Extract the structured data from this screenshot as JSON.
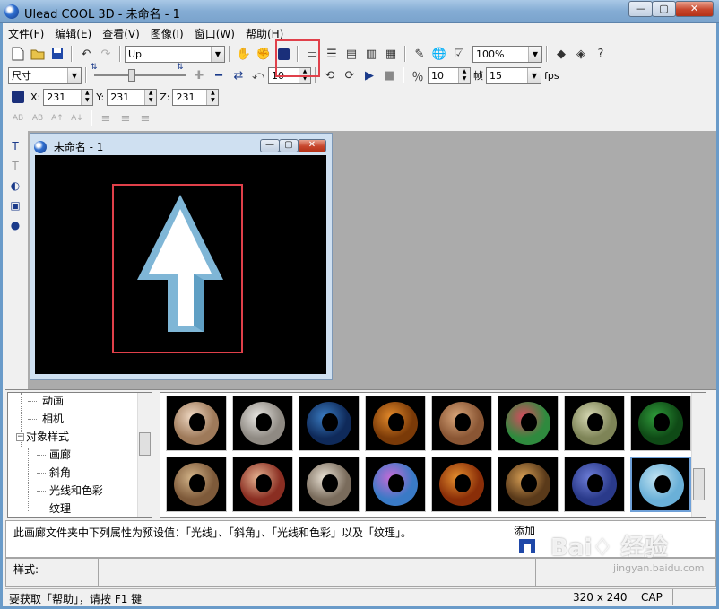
{
  "window": {
    "title": "Ulead COOL 3D - 未命名 - 1",
    "min_label": "—",
    "max_label": "▢",
    "close_label": "✕"
  },
  "menu": [
    {
      "label": "文件(F)"
    },
    {
      "label": "编辑(E)"
    },
    {
      "label": "查看(V)"
    },
    {
      "label": "图像(I)"
    },
    {
      "label": "窗口(W)"
    },
    {
      "label": "帮助(H)"
    }
  ],
  "toolbar1": {
    "object_combo": "Up",
    "zoom_combo": "100%"
  },
  "toolbar2": {
    "mode_combo": "尺寸",
    "value1": "10",
    "frame_value": "10",
    "frame_label": "帧",
    "fps_value": "15",
    "fps_label": "fps"
  },
  "toolbar3": {
    "x_label": "X:",
    "x_value": "231",
    "y_label": "Y:",
    "y_value": "231",
    "z_label": "Z:",
    "z_value": "231"
  },
  "document": {
    "title": "未命名 - 1"
  },
  "tree": {
    "items": [
      {
        "label": "动画",
        "level": 1
      },
      {
        "label": "相机",
        "level": 1
      },
      {
        "label": "对象样式",
        "level": 0
      },
      {
        "label": "画廊",
        "level": 1
      },
      {
        "label": "斜角",
        "level": 1
      },
      {
        "label": "光线和色彩",
        "level": 1
      },
      {
        "label": "纹理",
        "level": 1
      }
    ],
    "expander_label": "−"
  },
  "thumbnails": [
    {
      "colors": [
        "#f0d9c4",
        "#9e7a5a"
      ]
    },
    {
      "colors": [
        "#e8e6e2",
        "#8f8a83"
      ]
    },
    {
      "colors": [
        "#3a7cc2",
        "#0f2a5a"
      ]
    },
    {
      "colors": [
        "#e38a2b",
        "#7a3a08"
      ]
    },
    {
      "colors": [
        "#d9a67a",
        "#8a5634"
      ]
    },
    {
      "colors": [
        "#d64b5e",
        "#2f8a3e"
      ]
    },
    {
      "colors": [
        "#d7d9b4",
        "#7e8457"
      ]
    },
    {
      "colors": [
        "#2f9a3a",
        "#0f4a16"
      ]
    },
    {
      "colors": [
        "#d3b489",
        "#7e5a3a"
      ]
    },
    {
      "colors": [
        "#e6b492",
        "#8a2e22"
      ]
    },
    {
      "colors": [
        "#e9e1d4",
        "#7a6c5c"
      ]
    },
    {
      "colors": [
        "#c56bd6",
        "#3a7ac6"
      ]
    },
    {
      "colors": [
        "#e5902f",
        "#8a2e08"
      ]
    },
    {
      "colors": [
        "#d69e54",
        "#5a3a1a"
      ]
    },
    {
      "colors": [
        "#6e7ed8",
        "#2a3a8a"
      ]
    },
    {
      "colors": [
        "#c2e4f2",
        "#6ab0d8"
      ]
    }
  ],
  "description": {
    "text": "此画廊文件夹中下列属性为预设值：「光线」、「斜角」、「光线和色彩」以及「纹理」。",
    "add_label": "添加"
  },
  "style_area": {
    "label": "样式:"
  },
  "statusbar": {
    "text": "要获取「帮助」，请按 F1 键",
    "resolution": "320 x 240",
    "cap": "CAP"
  },
  "watermark": {
    "main": "Bai♢ 经验",
    "sub": "jingyan.baidu.com"
  },
  "colors": {
    "highlight": "#e0404a",
    "arrow_face": "#ffffff",
    "arrow_edge": "#8fc3de"
  }
}
